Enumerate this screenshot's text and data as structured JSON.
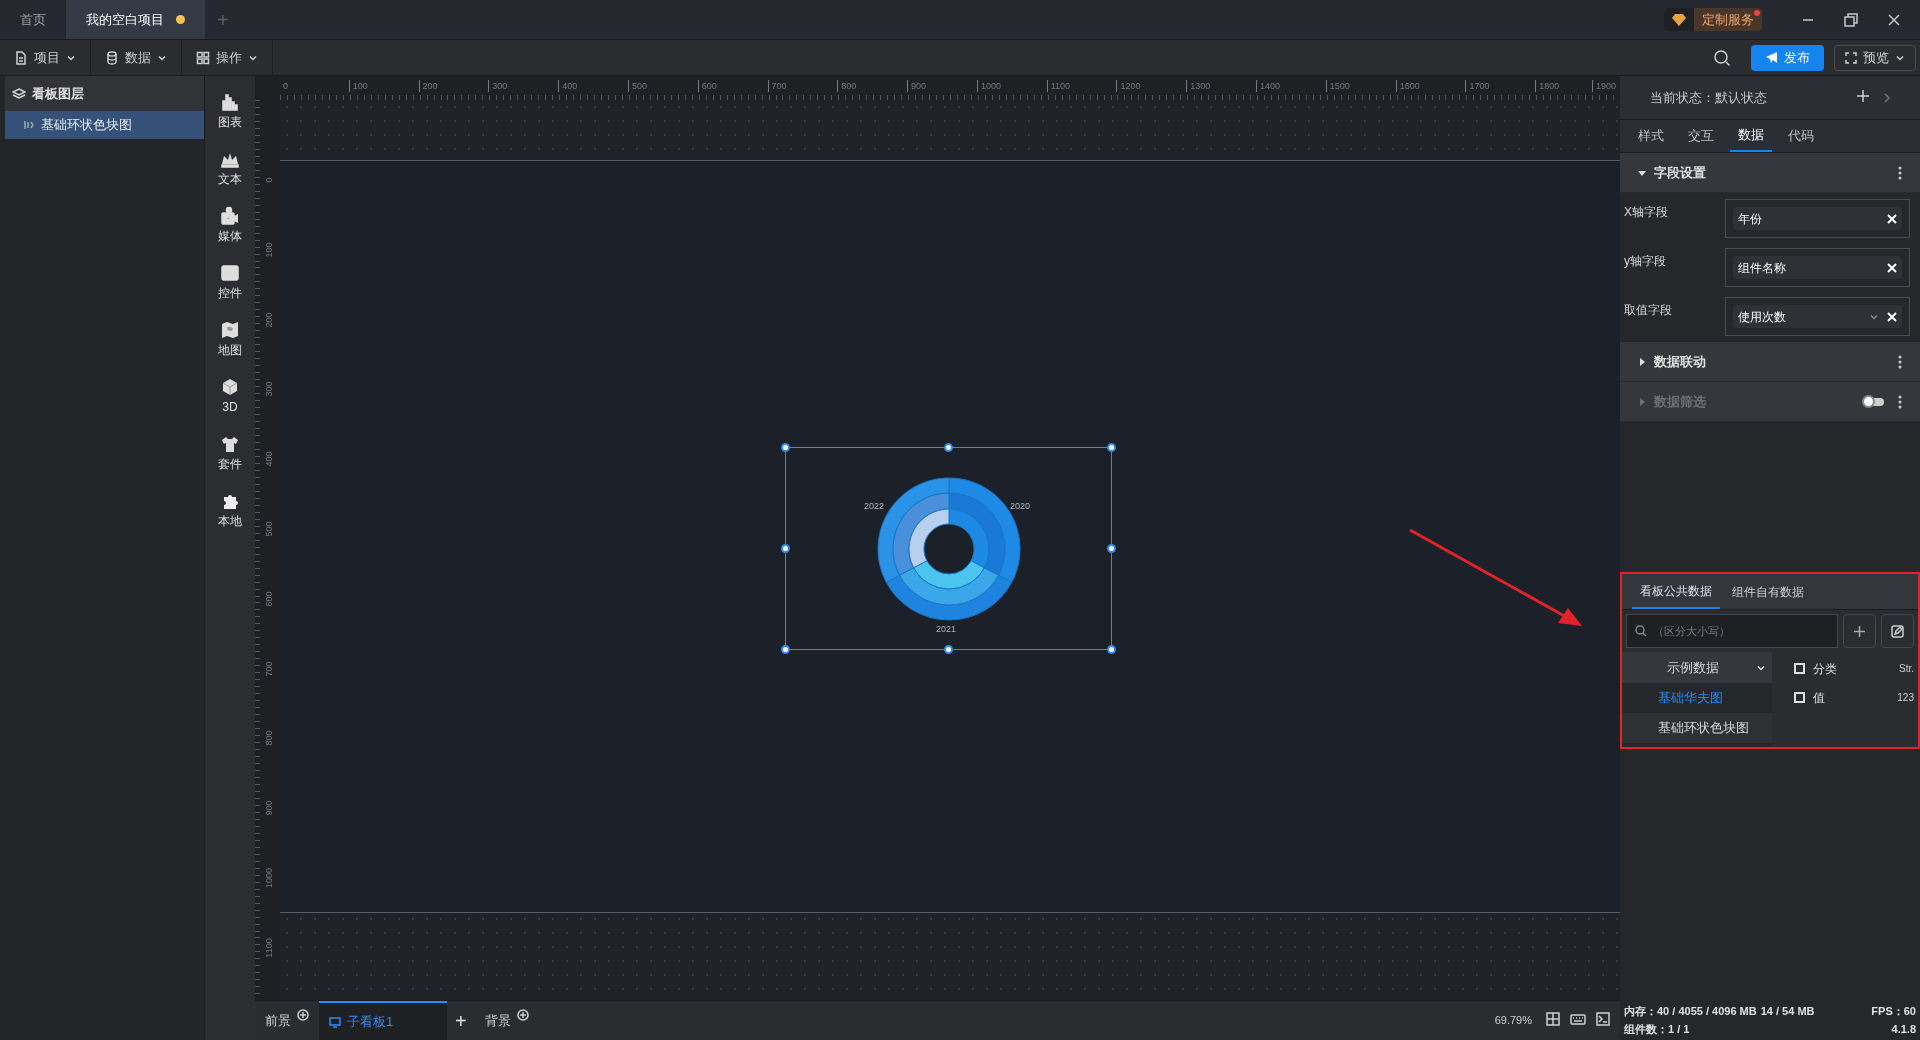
{
  "window_tabs": [
    {
      "label": "首页",
      "selected": false,
      "modified": false
    },
    {
      "label": "我的空白项目",
      "selected": true,
      "modified": true
    }
  ],
  "new_tab": "+",
  "custom_service": {
    "label": "定制服务",
    "notification": true
  },
  "menus": [
    {
      "label": "项目",
      "kind": "file"
    },
    {
      "label": "数据",
      "kind": "database"
    },
    {
      "label": "操作",
      "kind": "grid"
    }
  ],
  "publish": "发布",
  "preview": "预览",
  "layers": {
    "title": "看板图层",
    "items": [
      {
        "label": "基础环状色块图",
        "selected": true
      }
    ]
  },
  "component_tools": [
    {
      "label": "图表",
      "kind": "chart"
    },
    {
      "label": "文本",
      "kind": "crown"
    },
    {
      "label": "媒体",
      "kind": "media"
    },
    {
      "label": "控件",
      "kind": "control"
    },
    {
      "label": "地图",
      "kind": "map"
    },
    {
      "label": "3D",
      "kind": "cube"
    },
    {
      "label": "套件",
      "kind": "shirt"
    },
    {
      "label": "本地",
      "kind": "puzzle"
    }
  ],
  "ruler": {
    "x_labels": [
      "0",
      "100",
      "200",
      "300",
      "400",
      "500",
      "600",
      "700",
      "800",
      "900",
      "1000",
      "1100",
      "1200",
      "1300",
      "1400",
      "1500",
      "1600",
      "1700",
      "1800",
      "1900"
    ],
    "y_labels": [
      "0",
      "100",
      "200",
      "300",
      "400",
      "500",
      "600",
      "700",
      "800",
      "900",
      "1000",
      "1100"
    ]
  },
  "component": {
    "selected": true,
    "labels": [
      "2022",
      "2020",
      "2021"
    ]
  },
  "bottom_tabs": [
    {
      "label": "前景",
      "selected": false,
      "kind": "layer"
    },
    {
      "label": "子看板1",
      "selected": true,
      "kind": "board"
    },
    {
      "label": "+",
      "selected": false,
      "kind": "add"
    },
    {
      "label": "背景",
      "selected": false,
      "kind": "layer"
    }
  ],
  "zoom": "69.79%",
  "right_panel": {
    "state": "当前状态：默认状态",
    "tabs": [
      {
        "label": "样式",
        "selected": false
      },
      {
        "label": "交互",
        "selected": false
      },
      {
        "label": "数据",
        "selected": true
      },
      {
        "label": "代码",
        "selected": false
      }
    ],
    "field_section": {
      "title": "字段设置",
      "expanded": true,
      "fields": [
        {
          "label": "X轴字段",
          "value": "年份",
          "dropdown": false
        },
        {
          "label": "y轴字段",
          "value": "组件名称",
          "dropdown": false
        },
        {
          "label": "取值字段",
          "value": "使用次数",
          "dropdown": true
        }
      ]
    },
    "sections": [
      {
        "title": "数据联动",
        "disabled": false,
        "toggle": false
      },
      {
        "title": "数据筛选",
        "disabled": true,
        "toggle": true
      }
    ],
    "data_tabs": [
      {
        "label": "看板公共数据",
        "selected": true
      },
      {
        "label": "组件自有数据",
        "selected": false
      }
    ],
    "search": {
      "placeholder": "（区分大小写）"
    },
    "dataset_group": "示例数据",
    "datasets": [
      {
        "label": "基础华夫图",
        "selected": true
      },
      {
        "label": "基础环状色块图",
        "selected": false
      }
    ],
    "columns": [
      {
        "name": "分类",
        "type": "Str.",
        "checked": false
      },
      {
        "name": "值",
        "type": "123",
        "checked": false
      }
    ]
  },
  "status": {
    "memory": "内存：40 / 4055 / 4096 MB",
    "gpu": "14 / 54 MB",
    "fps": "FPS：60",
    "components": "组件数：1 / 1",
    "version": "4.1.8"
  }
}
